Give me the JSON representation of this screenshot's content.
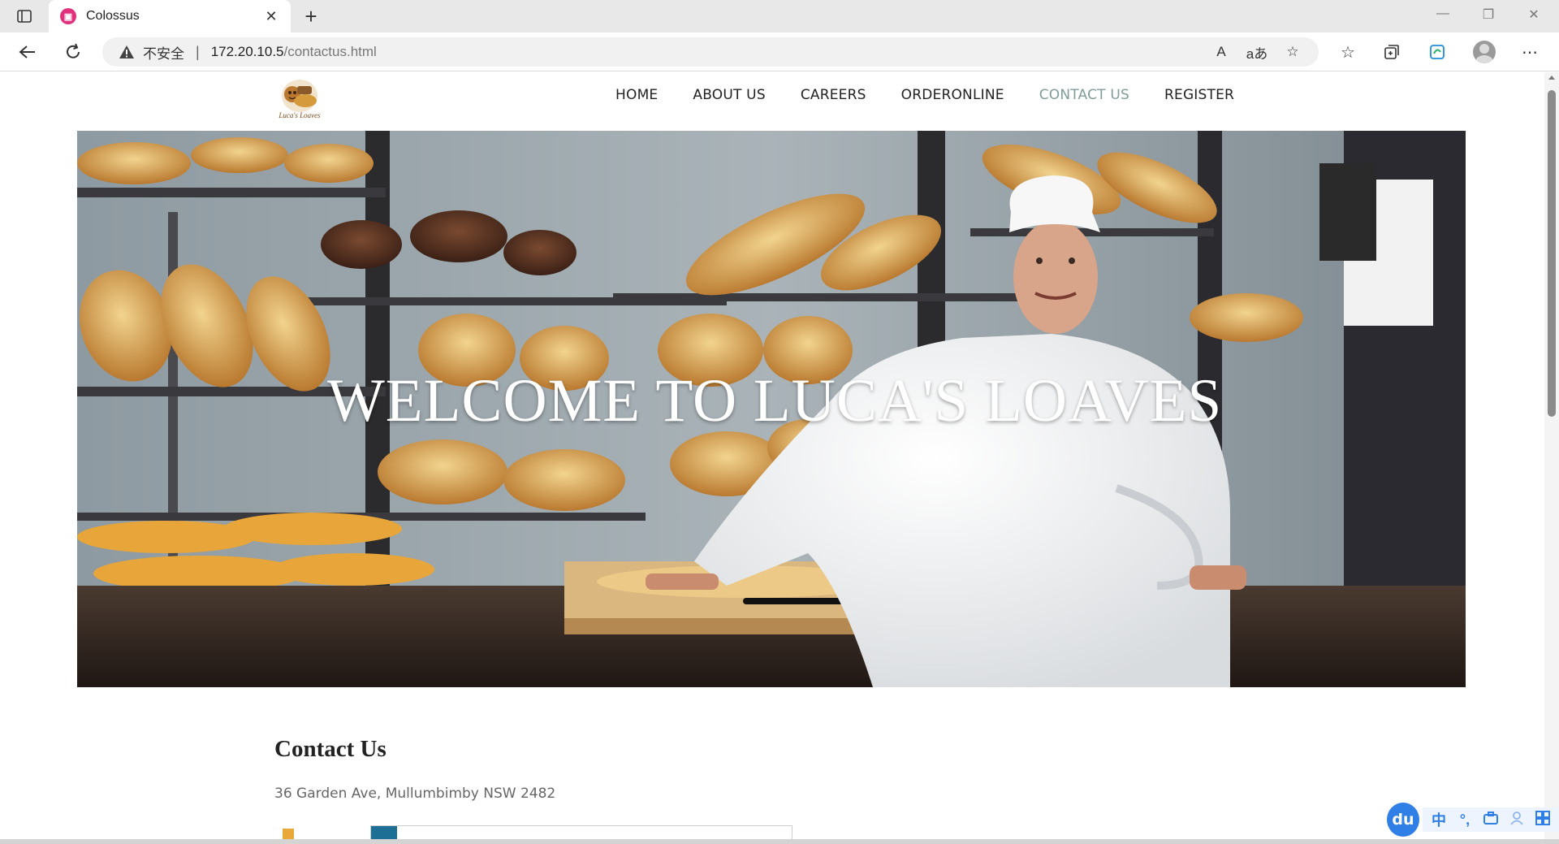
{
  "browser": {
    "tab_title": "Colossus",
    "tab_favicon": "colossus-icon",
    "address": {
      "security_label": "不安全",
      "separator": "|",
      "host": "172.20.10.5",
      "path": "/contactus.html"
    },
    "omnibox_icons": [
      "read-aloud-icon",
      "translate-icon",
      "add-favorite-icon"
    ],
    "toolbar_icons": [
      "favorites-icon",
      "collections-icon",
      "browser-essentials-icon",
      "profile-icon",
      "more-icon"
    ],
    "omnibox_text": {
      "read_aloud": "A",
      "translate": "aあ"
    }
  },
  "site": {
    "logo_alt": "Luca's Loaves logo",
    "nav": [
      {
        "label": "HOME",
        "active": false
      },
      {
        "label": "ABOUT US",
        "active": false
      },
      {
        "label": "CAREERS",
        "active": false
      },
      {
        "label": "ORDERONLINE",
        "active": false
      },
      {
        "label": "CONTACT US",
        "active": true
      },
      {
        "label": "REGISTER",
        "active": false
      }
    ],
    "hero": {
      "title": "WELCOME TO LUCA'S LOAVES",
      "image": "bakery-chef-with-bread-shelves"
    },
    "contact": {
      "heading": "Contact Us",
      "address": "36 Garden Ave, Mullumbimby NSW 2482"
    }
  },
  "ime": {
    "logo": "du",
    "items": [
      "中",
      "°,",
      "toolbox-icon",
      "user-icon",
      "grid-icon"
    ]
  },
  "colors": {
    "nav_active": "#7f9c99",
    "ime_blue": "#2f7fe6"
  }
}
